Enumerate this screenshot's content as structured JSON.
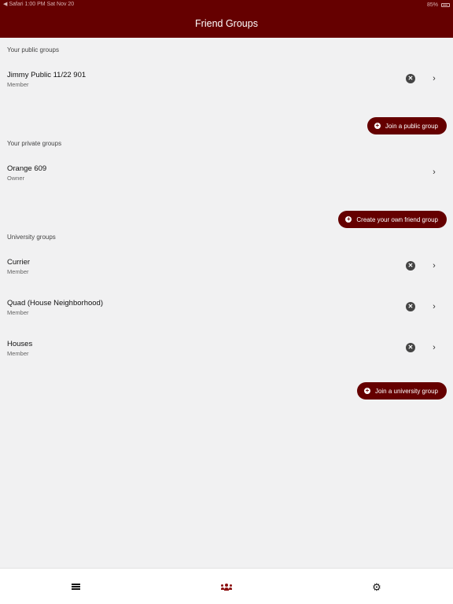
{
  "status_bar": {
    "left": "◀ Safari  1:00 PM  Sat Nov 20",
    "battery": "85%"
  },
  "header": {
    "title": "Friend Groups"
  },
  "sections": {
    "public": {
      "title": "Your public groups",
      "groups": [
        {
          "name": "Jimmy Public 11/22  901",
          "role": "Member"
        }
      ],
      "button_label": "Join a public group"
    },
    "private": {
      "title": "Your private groups",
      "groups": [
        {
          "name": "Orange 609",
          "role": "Owner"
        }
      ],
      "button_label": "Create your own friend group"
    },
    "university": {
      "title": "University groups",
      "groups": [
        {
          "name": "Currier",
          "role": "Member"
        },
        {
          "name": "Quad (House Neighborhood)",
          "role": "Member"
        },
        {
          "name": "Houses",
          "role": "Member"
        }
      ],
      "button_label": "Join a university group"
    }
  },
  "icons": {
    "remove": "✕",
    "chevron": "›",
    "plus": "+",
    "settings": "⚙"
  },
  "colors": {
    "brand": "#650000",
    "background": "#f1f1f2",
    "active_tab": "#8b1010"
  },
  "tab_bar": {
    "items": [
      "menu-icon",
      "groups-icon",
      "gear-icon"
    ],
    "active": "groups"
  }
}
